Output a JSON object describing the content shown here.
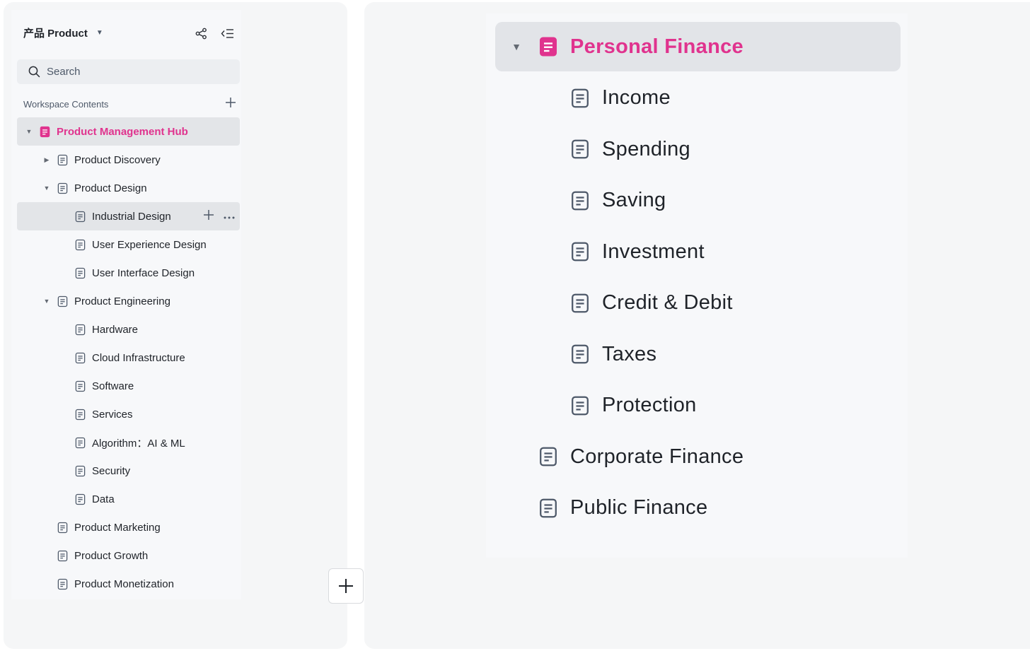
{
  "colors": {
    "accent": "#e0338e",
    "text": "#1f2329",
    "muted": "#4e5969",
    "selected_bg": "#e3e5e8"
  },
  "workspace": {
    "name": "产品 Product"
  },
  "search": {
    "placeholder": "Search"
  },
  "section": {
    "title": "Workspace Contents"
  },
  "tree": [
    {
      "label": "Product Management Hub",
      "level": 0,
      "caret": "down",
      "selected": true
    },
    {
      "label": "Product Discovery",
      "level": 1,
      "caret": "right"
    },
    {
      "label": "Product Design",
      "level": 1,
      "caret": "down"
    },
    {
      "label": "Industrial Design",
      "level": 2,
      "hovered": true
    },
    {
      "label": "User Experience Design",
      "level": 2
    },
    {
      "label": "User Interface Design",
      "level": 2
    },
    {
      "label": "Product Engineering",
      "level": 1,
      "caret": "down"
    },
    {
      "label": "Hardware",
      "level": 2
    },
    {
      "label": "Cloud Infrastructure",
      "level": 2
    },
    {
      "label": "Software",
      "level": 2
    },
    {
      "label": "Services",
      "level": 2
    },
    {
      "label": "Algorithm：AI & ML",
      "level": 2
    },
    {
      "label": "Security",
      "level": 2
    },
    {
      "label": "Data",
      "level": 2
    },
    {
      "label": "Product Marketing",
      "level": 1
    },
    {
      "label": "Product Growth",
      "level": 1
    },
    {
      "label": "Product Monetization",
      "level": 1
    }
  ],
  "zoom_tree": {
    "root": "Personal Finance",
    "children": [
      "Income",
      "Spending",
      "Saving",
      "Investment",
      "Credit & Debit",
      "Taxes",
      "Protection"
    ],
    "siblings": [
      "Corporate Finance",
      "Public Finance"
    ]
  }
}
